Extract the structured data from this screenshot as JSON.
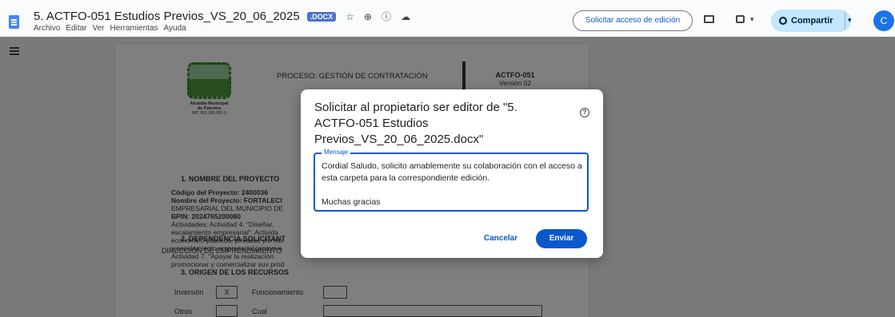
{
  "header": {
    "doc_title": "5. ACTFO-051 Estudios Previos_VS_20_06_2025",
    "file_badge": ".DOCX",
    "menu": [
      "Archivo",
      "Editar",
      "Ver",
      "Herramientas",
      "Ayuda"
    ],
    "request_edit_label": "Solicitar acceso de edición",
    "share_label": "Compartir",
    "avatar_letter": "C"
  },
  "document": {
    "logo_name": "Alcaldía Municipal",
    "logo_sub": "de Palestra",
    "logo_nit": "NIT. 891.380.007-3",
    "process_title": "PROCESO: GESTIÓN DE CONTRATACIÓN",
    "code": "ACTFO-051",
    "version": "Versión 02",
    "section1": "1.   NOMBRE DEL PROYECTO",
    "body_lines": [
      "Código del Proyecto: 2400036",
      "Nombre del Proyecto: FORTALECI",
      "EMPRESARIAL DEL MUNICIPIO DE",
      "BPIN: 2024765200080",
      "Actividades: Actividad 4. \"Diseñar,",
      "escalamiento empresarial\". Activida",
      "económico públicos, privados y/o mu",
      "y escalamiento empresarial promove",
      "Actividad 7. \"Apoyar la realización",
      "promocionar y comercializar sus prod"
    ],
    "section2": "2.   DEPENDENCIA SOLICITANT",
    "dependency": "DIRECCIÓN DE EMPRENDIMIENTO",
    "section3": "3.   ORIGEN DE LOS RECURSOS",
    "inversion_label": "Inversión",
    "inversion_mark": "X",
    "funcionamiento_label": "Funcionamiento",
    "otros_label": "Otros",
    "cual_label": "Cual"
  },
  "dialog": {
    "title": "Solicitar al propietario ser editor de \"5. ACTFO-051 Estudios Previos_VS_20_06_2025.docx\"",
    "message_label": "Mensaje",
    "message_value": "Cordial Saludo, solicito amablemente su colaboración con el acceso a esta carpeta para la correspondiente edición.\n\nMuchas gracias",
    "cancel_label": "Cancelar",
    "send_label": "Enviar"
  },
  "colors": {
    "accent": "#0b57d0",
    "share_bg": "#c2e7ff",
    "doc_blue": "#4285f4",
    "scrim": "rgba(0,0,0,0.5)"
  },
  "icons": [
    "docs-icon",
    "star-icon",
    "move-icon",
    "info-icon",
    "cloud-icon",
    "comments-icon",
    "meet-icon",
    "globe-icon",
    "outline-icon",
    "help-icon"
  ]
}
